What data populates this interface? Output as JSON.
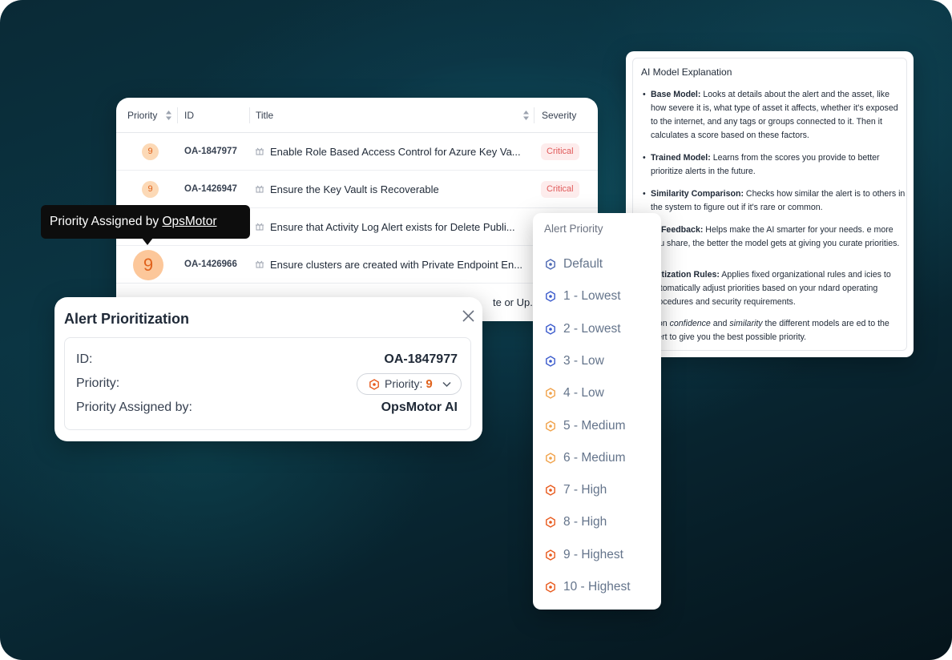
{
  "table": {
    "headers": {
      "priority": "Priority",
      "id": "ID",
      "title": "Title",
      "severity": "Severity"
    },
    "rows": [
      {
        "priority": "9",
        "id": "OA-1847977",
        "title": "Enable Role Based Access Control for Azure Key Va...",
        "severity": "Critical"
      },
      {
        "priority": "9",
        "id": "OA-1426947",
        "title": "Ensure the Key Vault is Recoverable",
        "severity": "Critical"
      },
      {
        "priority": "",
        "id": "",
        "title": "Ensure that Activity Log Alert exists for Delete Publi...",
        "severity": ""
      },
      {
        "priority": "9",
        "id": "OA-1426966",
        "title": "Ensure clusters are created with Private Endpoint En...",
        "severity": ""
      },
      {
        "priority": "",
        "id": "",
        "title": "te or Up...",
        "severity": ""
      }
    ]
  },
  "tooltip": {
    "prefix": "Priority Assigned by ",
    "link": "OpsMotor"
  },
  "dialog": {
    "title": "Alert Prioritization",
    "id_label": "ID:",
    "id_value": "OA-1847977",
    "priority_label": "Priority:",
    "priority_select_label": "Priority:",
    "priority_select_value": "9",
    "assigned_label": "Priority Assigned by:",
    "assigned_value": "OpsMotor AI"
  },
  "dropdown": {
    "header": "Alert Priority",
    "options": [
      {
        "label": "Default",
        "color": "#4b67b3"
      },
      {
        "label": "1 - Lowest",
        "color": "#3b5bcc"
      },
      {
        "label": "2 - Lowest",
        "color": "#3b5bcc"
      },
      {
        "label": "3 - Low",
        "color": "#3b5bcc"
      },
      {
        "label": "4 - Low",
        "color": "#f0a24a"
      },
      {
        "label": "5 - Medium",
        "color": "#f0a24a"
      },
      {
        "label": "6 - Medium",
        "color": "#f0a24a"
      },
      {
        "label": "7 - High",
        "color": "#e8591c"
      },
      {
        "label": "8 - High",
        "color": "#e8591c"
      },
      {
        "label": "9 - Highest",
        "color": "#e8591c"
      },
      {
        "label": "10 - Highest",
        "color": "#e8591c"
      }
    ]
  },
  "ai_explanation": {
    "title": "AI Model Explanation",
    "items": [
      {
        "term": "Base Model:",
        "text": " Looks at details about the alert and the asset, like how severe it is, what type of asset it affects, whether it's exposed to the internet, and any tags or groups connected to it. Then it calculates a score based on these factors."
      },
      {
        "term": "Trained Model:",
        "text": " Learns from the scores you provide to better prioritize alerts in the future."
      },
      {
        "term": "Similarity Comparison:",
        "text": " Checks how similar the alert is to others in the system to figure out if it's rare or common."
      },
      {
        "term": "er Feedback:",
        "text": " Helps make the AI smarter for your needs. e more you share, the better the model gets at giving you curate priorities."
      },
      {
        "term": "oritization Rules:",
        "text": " Applies fixed organizational rules and icies to automatically adjust priorities based on your ndard operating procedures and security requirements."
      }
    ],
    "note_prefix": "d on ",
    "note_em1": "confidence",
    "note_mid": " and ",
    "note_em2": "similarity",
    "note_suffix": " the different models are ed to the alert to give you the best possible priority."
  },
  "colors": {
    "accent_orange": "#e0621c",
    "critical_red": "#e05a5a",
    "badge_bg": "#fcd9b6"
  }
}
